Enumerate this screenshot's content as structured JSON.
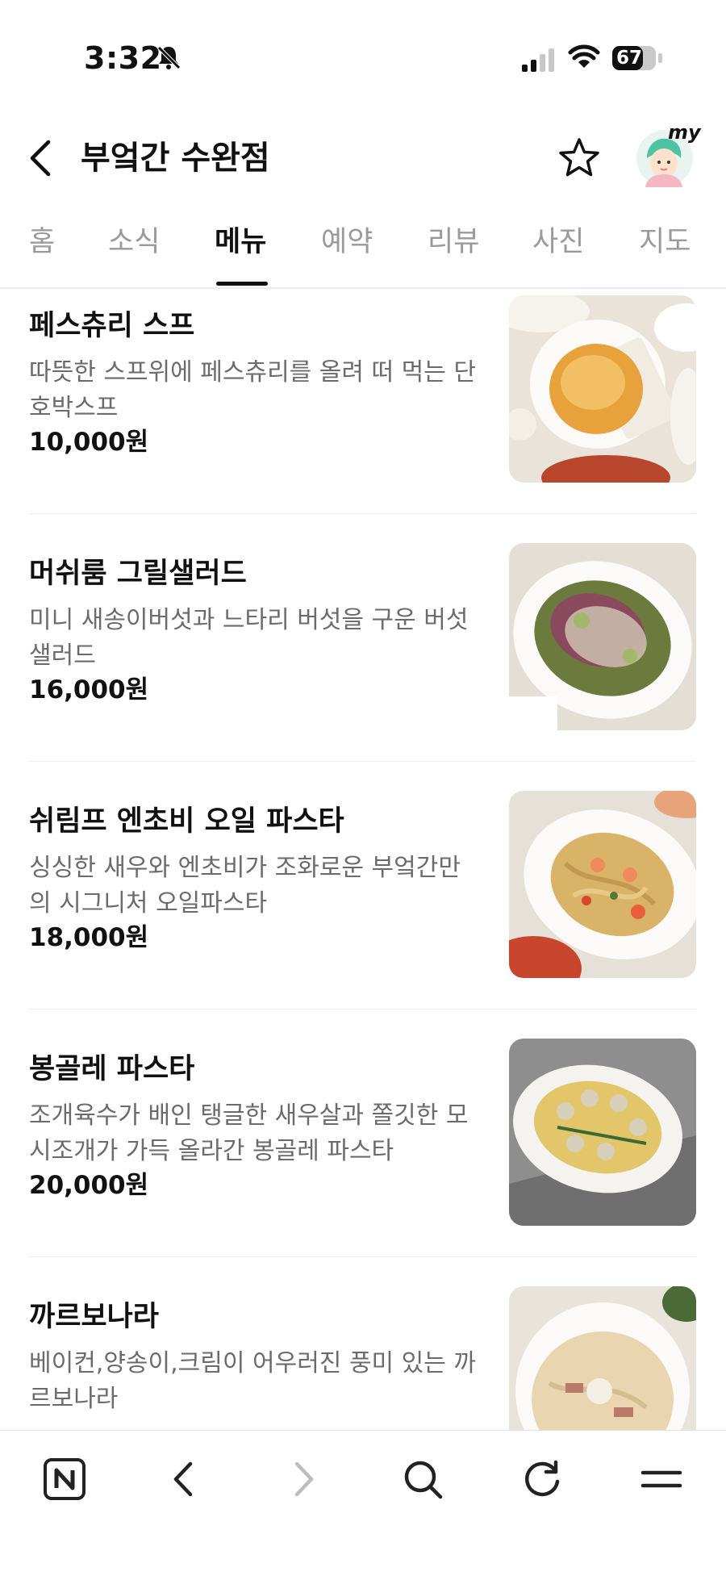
{
  "status_bar": {
    "time": "3:32",
    "battery": "67",
    "icons": [
      "bell-slash-icon",
      "signal-icon",
      "wifi-icon",
      "battery-icon"
    ]
  },
  "header": {
    "title": "부엌간 수완점",
    "avatar_label": "my",
    "icons": [
      "back-arrow-icon",
      "star-icon",
      "avatar"
    ]
  },
  "tabs": [
    {
      "label": "홈",
      "active": false
    },
    {
      "label": "소식",
      "active": false
    },
    {
      "label": "메뉴",
      "active": true
    },
    {
      "label": "예약",
      "active": false
    },
    {
      "label": "리뷰",
      "active": false
    },
    {
      "label": "사진",
      "active": false
    },
    {
      "label": "지도",
      "active": false
    }
  ],
  "menu": {
    "items": [
      {
        "name": "페스츄리 스프",
        "description": "따뜻한 스프위에 페스츄리를 올려 떠 먹는 단호박스프",
        "price": "10,000원"
      },
      {
        "name": "머쉬룸 그릴샐러드",
        "description": "미니 새송이버섯과 느타리 버섯을 구운 버섯 샐러드",
        "price": "16,000원"
      },
      {
        "name": "쉬림프 엔초비 오일 파스타",
        "description": "싱싱한 새우와 엔초비가 조화로운 부엌간만의 시그니처 오일파스타",
        "price": "18,000원"
      },
      {
        "name": "봉골레 파스타",
        "description": "조개육수가 배인 탱글한 새우살과 쫄깃한 모시조개가 가득 올라간 봉골레 파스타",
        "price": "20,000원"
      },
      {
        "name": "까르보나라",
        "description": "베이컨,양송이,크림이 어우러진 풍미 있는 까르보나라",
        "price": ""
      }
    ]
  },
  "toolbar": {
    "icons": [
      "naver-home-icon",
      "back-icon",
      "forward-icon",
      "search-icon",
      "refresh-icon",
      "menu-icon"
    ]
  },
  "colors": {
    "text_primary": "#111111",
    "text_secondary": "#6b6b6b",
    "tab_inactive": "#9a9a9a",
    "divider": "#eeeeee"
  }
}
